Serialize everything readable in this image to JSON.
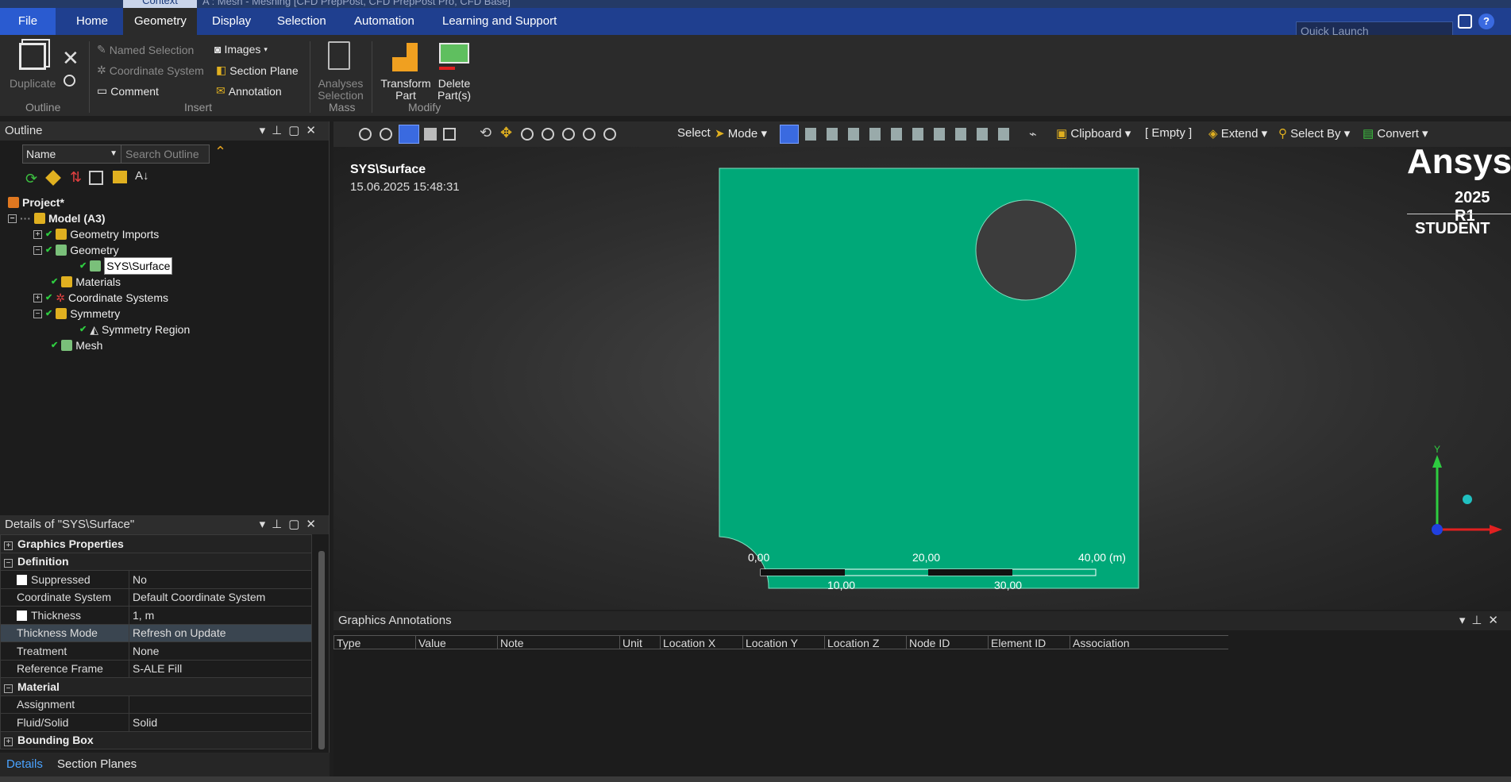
{
  "window": {
    "context_tab": "Context",
    "title": "A : Mesh - Meshing [CFD PrepPost, CFD PrepPost Pro, CFD Base]"
  },
  "ribbon_tabs": [
    "File",
    "Home",
    "Geometry",
    "Display",
    "Selection",
    "Automation",
    "Learning and Support"
  ],
  "active_tab": "Geometry",
  "quick_launch": {
    "placeholder": "Quick Launch"
  },
  "ribbon": {
    "duplicate": "Duplicate",
    "named_selection": "Named Selection",
    "coordinate_system": "Coordinate System",
    "comment": "Comment",
    "images": "Images",
    "section_plane": "Section Plane",
    "annotation": "Annotation",
    "analyses_selection_1": "Analyses",
    "analyses_selection_2": "Selection",
    "transform_1": "Transform",
    "transform_2": "Part",
    "delete_1": "Delete",
    "delete_2": "Part(s)",
    "groups": {
      "outline": "Outline",
      "insert": "Insert",
      "mass": "Mass",
      "modify": "Modify"
    }
  },
  "outline": {
    "title": "Outline",
    "filter_name": "Name",
    "search_placeholder": "Search Outline",
    "tree": [
      {
        "label": "Project*"
      },
      {
        "label": "Model (A3)"
      },
      {
        "label": "Geometry Imports"
      },
      {
        "label": "Geometry"
      },
      {
        "label": "SYS\\Surface"
      },
      {
        "label": "Materials"
      },
      {
        "label": "Coordinate Systems"
      },
      {
        "label": "Symmetry"
      },
      {
        "label": "Symmetry Region"
      },
      {
        "label": "Mesh"
      }
    ]
  },
  "details": {
    "title": "Details of \"SYS\\Surface\"",
    "rows": [
      {
        "type": "section",
        "label": "Graphics Properties",
        "expander": "+"
      },
      {
        "type": "section",
        "label": "Definition",
        "expander": "−"
      },
      {
        "label": "Suppressed",
        "value": "No",
        "checkbox": true
      },
      {
        "label": "Coordinate System",
        "value": "Default Coordinate System"
      },
      {
        "label": "Thickness",
        "value": "1, m",
        "checkbox": true
      },
      {
        "label": "Thickness Mode",
        "value": "Refresh on Update",
        "highlight": true
      },
      {
        "label": "Treatment",
        "value": "None"
      },
      {
        "label": "Reference Frame",
        "value": "S-ALE Fill"
      },
      {
        "type": "section",
        "label": "Material",
        "expander": "−"
      },
      {
        "label": "Assignment",
        "value": ""
      },
      {
        "label": "Fluid/Solid",
        "value": "Solid"
      },
      {
        "type": "section",
        "label": "Bounding Box",
        "expander": "+"
      }
    ],
    "tabs": [
      "Details",
      "Section Planes"
    ]
  },
  "viewport_toolbar": {
    "select": "Select",
    "mode": "Mode",
    "clipboard": "Clipboard",
    "empty": "[ Empty ]",
    "extend": "Extend",
    "select_by": "Select By",
    "convert": "Convert"
  },
  "viewport": {
    "label_title": "SYS\\Surface",
    "label_date": "15.06.2025 15:48:31",
    "brand": "Ansys",
    "version": "2025 R1",
    "edition": "STUDENT",
    "scale_top": [
      "0,00",
      "20,00",
      "40,00 (m)"
    ],
    "scale_bottom": [
      "10,00",
      "30,00"
    ],
    "axis_y": "Y",
    "model_color": "#00a878"
  },
  "annotations": {
    "title": "Graphics Annotations",
    "columns": [
      "Type",
      "Value",
      "Note",
      "Unit",
      "Location X",
      "Location Y",
      "Location Z",
      "Node ID",
      "Element ID",
      "Association"
    ]
  }
}
